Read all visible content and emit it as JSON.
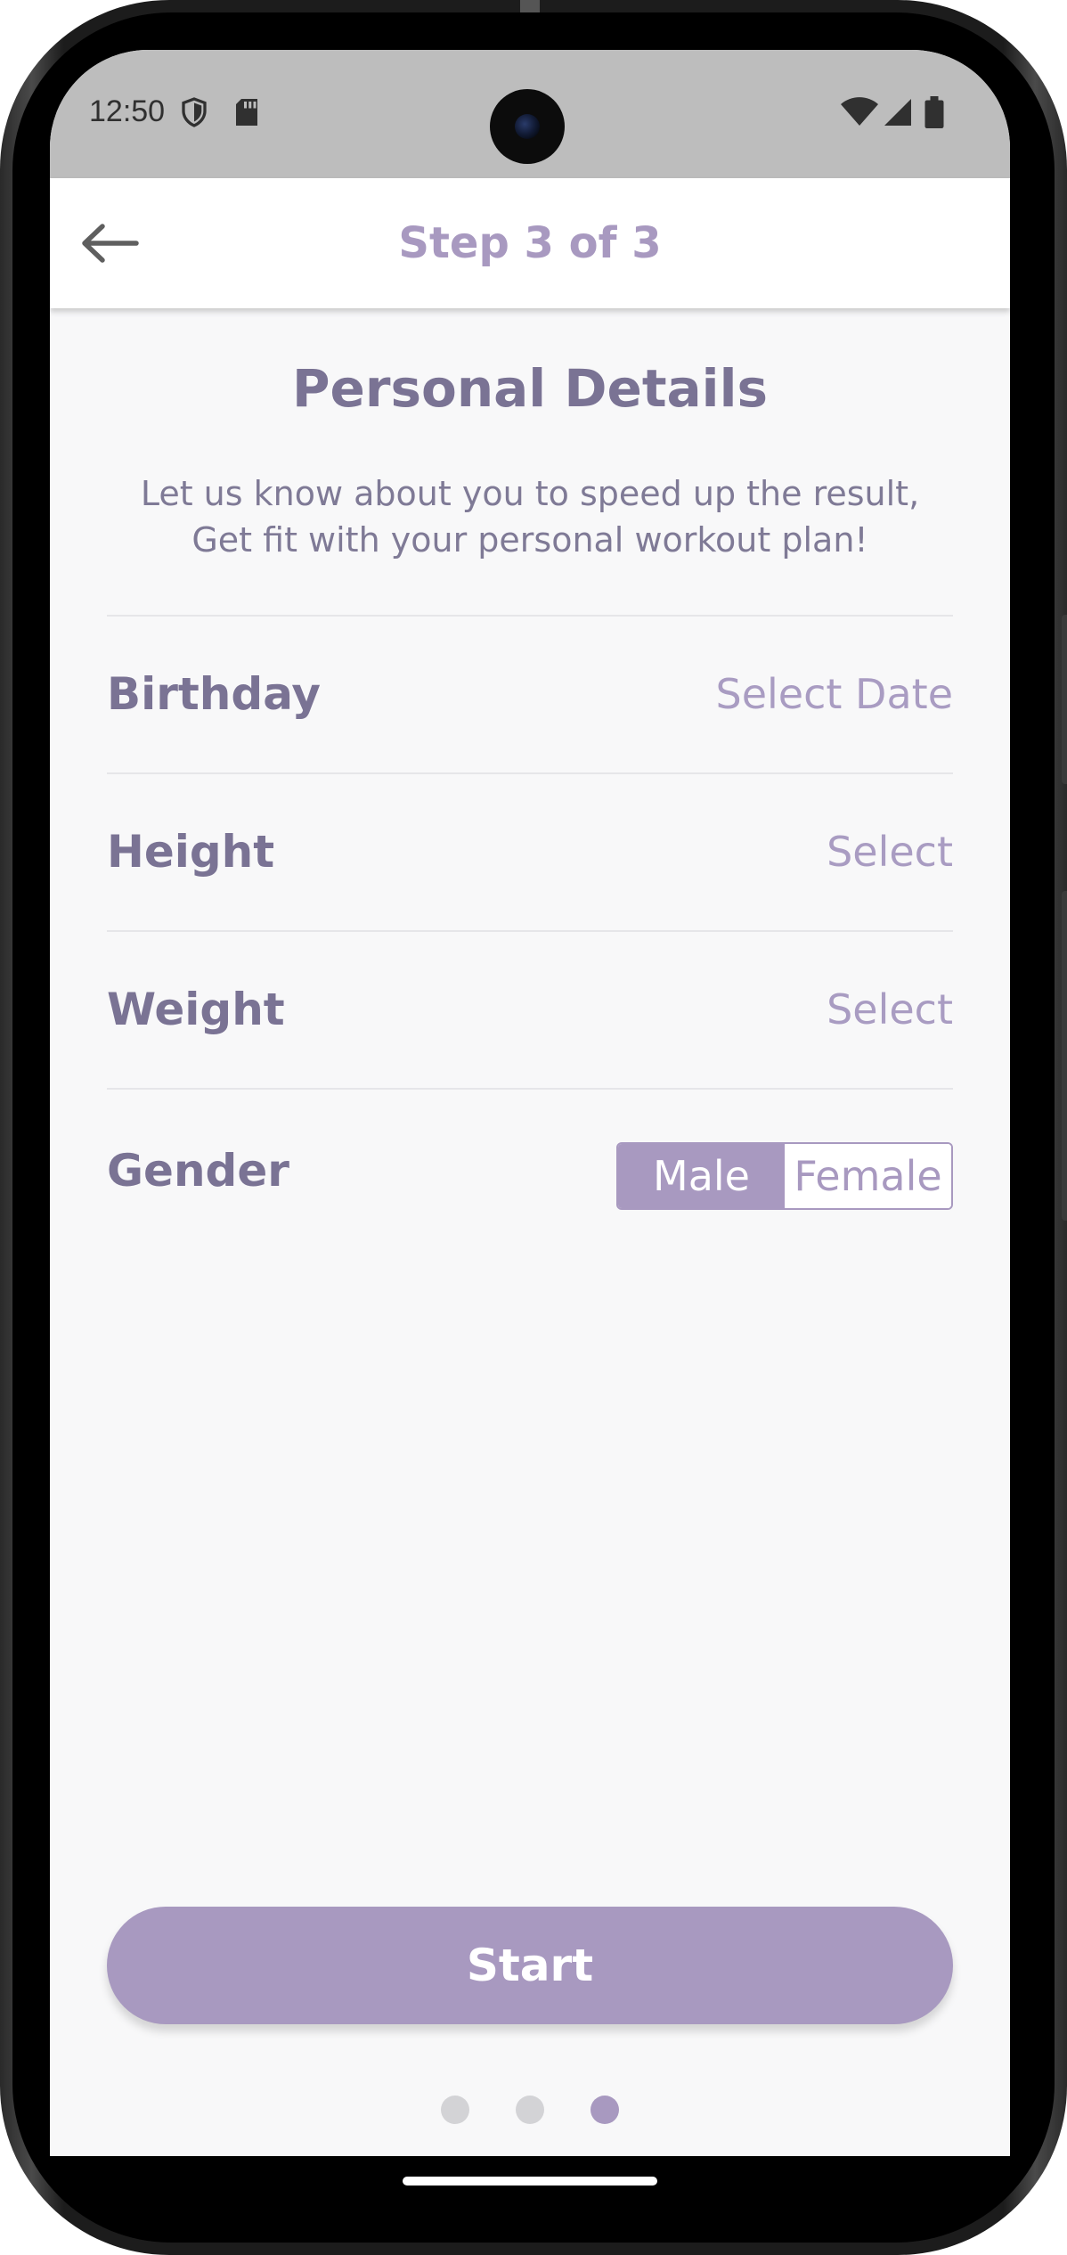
{
  "status_bar": {
    "time": "12:50",
    "icons": [
      "shield-icon",
      "sd-card-icon",
      "wifi-icon",
      "cellular-signal-icon",
      "battery-icon"
    ]
  },
  "app_bar": {
    "back_icon": "arrow-left-icon",
    "title": "Step 3 of 3"
  },
  "main": {
    "heading": "Personal Details",
    "subtitle_line1": "Let us know about you to speed up the result,",
    "subtitle_line2": "Get fit with your personal workout plan!",
    "rows": [
      {
        "label": "Birthday",
        "value": "Select Date"
      },
      {
        "label": "Height",
        "value": "Select"
      },
      {
        "label": "Weight",
        "value": "Select"
      }
    ],
    "gender": {
      "label": "Gender",
      "options": [
        "Male",
        "Female"
      ],
      "selected": "Male"
    },
    "start_button": "Start",
    "pager": {
      "total": 3,
      "current": 3
    }
  },
  "colors": {
    "accent": "#a899c0",
    "heading_text": "#7a7394",
    "background": "#f8f8f9"
  }
}
